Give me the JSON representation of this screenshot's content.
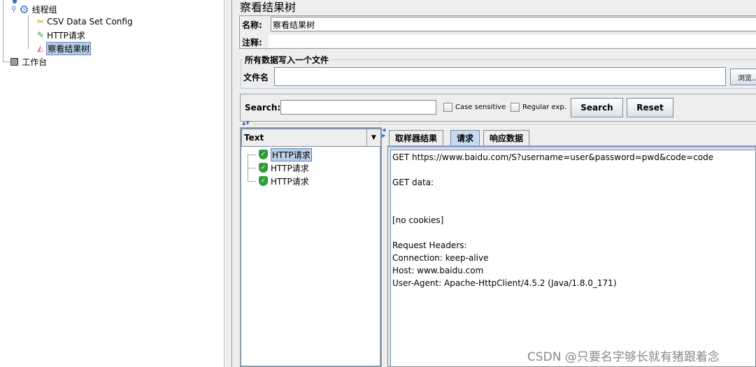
{
  "tree": {
    "items": [
      {
        "label": "线程组",
        "icon": "gear-icon"
      },
      {
        "label": "CSV Data Set Config",
        "icon": "tools-icon"
      },
      {
        "label": "HTTP请求",
        "icon": "pipette-icon"
      },
      {
        "label": "察看结果树",
        "icon": "chart-icon",
        "selected": true
      },
      {
        "label": "工作台",
        "icon": "notebook-icon"
      }
    ]
  },
  "panel": {
    "title": "察看结果树",
    "name_label": "名称:",
    "name_value": "察看结果树",
    "comment_label": "注释:",
    "comment_value": "",
    "file_group": "所有数据写入一个文件",
    "file_label": "文件名",
    "file_value": "",
    "browse_label": "浏览..."
  },
  "search": {
    "label": "Search:",
    "value": "",
    "case_sensitive": "Case sensitive",
    "regex": "Regular exp.",
    "search_btn": "Search",
    "reset_btn": "Reset"
  },
  "renderer": {
    "selected": "Text"
  },
  "results": [
    {
      "label": "HTTP请求",
      "status": "success"
    },
    {
      "label": "HTTP请求",
      "status": "success"
    },
    {
      "label": "HTTP请求",
      "status": "success"
    }
  ],
  "tabs": [
    {
      "label": "取样器结果"
    },
    {
      "label": "请求",
      "active": true
    },
    {
      "label": "响应数据"
    }
  ],
  "request_lines": [
    "GET https://www.baidu.com/S?username=user&password=pwd&code=code",
    "",
    "GET data:",
    "",
    "",
    "[no cookies]",
    "",
    "Request Headers:",
    "Connection: keep-alive",
    "Host: www.baidu.com",
    "User-Agent: Apache-HttpClient/4.5.2 (Java/1.8.0_171)"
  ],
  "watermark": "CSDN @只要名字够长就有猪跟着念"
}
